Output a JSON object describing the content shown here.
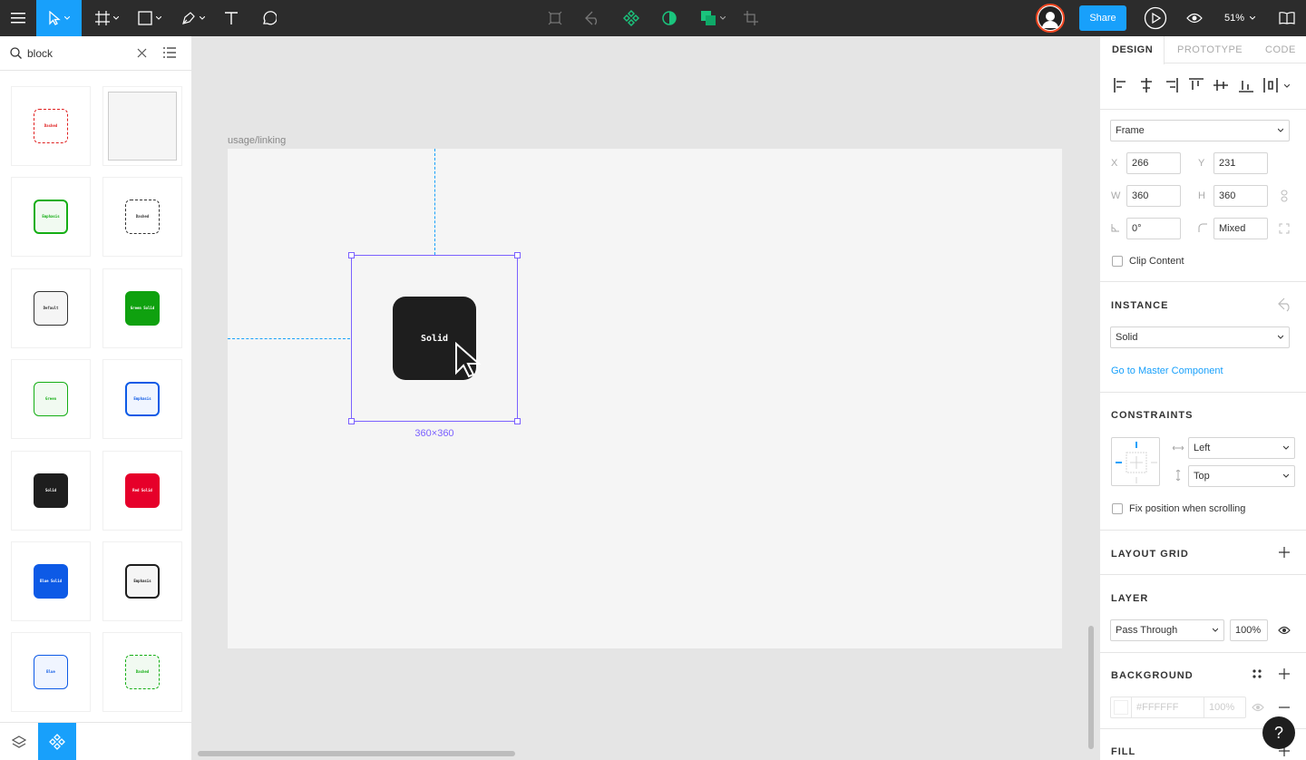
{
  "toolbar": {
    "share_label": "Share",
    "zoom_label": "51%"
  },
  "assets": {
    "search_value": "block",
    "tiles": [
      {
        "label": "Dashed",
        "style": "dashed-red"
      },
      {
        "label": "",
        "style": "large-grey"
      },
      {
        "label": "Emphasis",
        "style": "outline-green-thick"
      },
      {
        "label": "Dashed",
        "style": "dashed-dark"
      },
      {
        "label": "Default",
        "style": "outline-dark"
      },
      {
        "label": "Green Solid",
        "style": "solid-green"
      },
      {
        "label": "Green",
        "style": "outline-green"
      },
      {
        "label": "Emphasis",
        "style": "outline-blue-thick"
      },
      {
        "label": "Solid",
        "style": "solid-dark"
      },
      {
        "label": "Red Solid",
        "style": "solid-red"
      },
      {
        "label": "Blue Solid",
        "style": "solid-blue"
      },
      {
        "label": "Emphasis",
        "style": "outline-dark-thick"
      },
      {
        "label": "Blue",
        "style": "outline-blue"
      },
      {
        "label": "Dashed",
        "style": "dashed-green"
      }
    ]
  },
  "canvas": {
    "frame_name": "usage/linking",
    "block_label": "Solid",
    "size_label": "360×360"
  },
  "design": {
    "tabs": [
      {
        "label": "DESIGN",
        "active": true
      },
      {
        "label": "PROTOTYPE",
        "active": false
      },
      {
        "label": "CODE",
        "active": false
      }
    ],
    "frame_type": "Frame",
    "x_label": "X",
    "x": "266",
    "y_label": "Y",
    "y": "231",
    "w_label": "W",
    "w": "360",
    "h_label": "H",
    "h": "360",
    "rotation": "0°",
    "radius": "Mixed",
    "clip_content": "Clip Content",
    "instance_title": "INSTANCE",
    "instance_value": "Solid",
    "master_link": "Go to Master Component",
    "constraints_title": "CONSTRAINTS",
    "constraint_h": "Left",
    "constraint_v": "Top",
    "fix_position": "Fix position when scrolling",
    "layout_grid_title": "LAYOUT GRID",
    "layer_title": "LAYER",
    "blend_mode": "Pass Through",
    "opacity": "100%",
    "background_title": "BACKGROUND",
    "bg_hex": "#FFFFFF",
    "bg_opacity": "100%",
    "fill_title": "FILL"
  },
  "help_label": "?",
  "colors": {
    "accent": "#18a0fb",
    "selection": "#7b61ff",
    "toolbar_bg": "#2c2c2c",
    "component_green": "#1bc47d"
  }
}
